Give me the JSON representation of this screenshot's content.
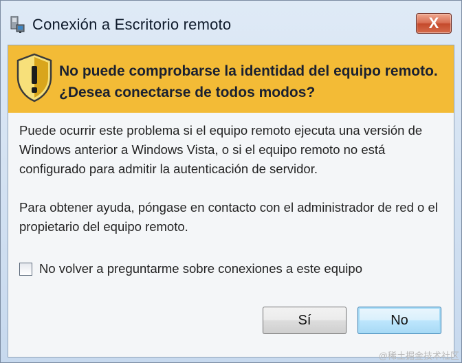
{
  "window": {
    "title": "Conexión a Escritorio remoto",
    "close_glyph": "X",
    "app_icon": "remote-desktop-icon"
  },
  "warning": {
    "icon": "shield-warning-icon",
    "line1": "No puede comprobarse la identidad del equipo remoto.",
    "line2": "¿Desea conectarse de todos modos?",
    "banner_color": "#f3bb36"
  },
  "body": {
    "paragraph1": "Puede ocurrir este problema si el equipo remoto ejecuta una versión de Windows anterior a Windows Vista, o si el equipo remoto no está configurado para admitir la autenticación de servidor.",
    "paragraph2": "Para obtener ayuda, póngase en contacto con el administrador de red o el propietario del equipo remoto."
  },
  "checkbox": {
    "label": "No volver a preguntarme sobre conexiones a este equipo",
    "checked": false
  },
  "buttons": {
    "yes": "Sí",
    "no": "No"
  },
  "watermark": "@稀土掘金技术社区"
}
